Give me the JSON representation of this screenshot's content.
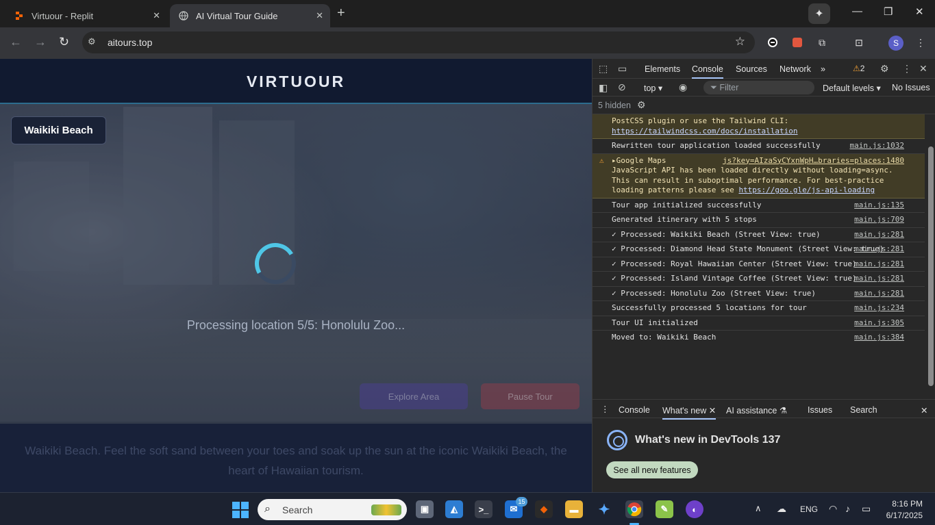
{
  "browser": {
    "tabs": [
      {
        "title": "Virtuour - Replit",
        "favicon": "replit-icon"
      },
      {
        "title": "AI Virtual Tour Guide",
        "favicon": "globe-icon"
      }
    ],
    "new_tab": "+",
    "url": "aitours.top",
    "profile_initial": "S"
  },
  "page": {
    "brand": "VIRTUOUR",
    "location_button": "Waikiki Beach",
    "status": "Processing location 5/5: Honolulu Zoo...",
    "explore_button": "Explore Area",
    "pause_button": "Pause Tour",
    "description": "Waikiki Beach. Feel the soft sand between your toes and soak up the sun at the iconic Waikiki Beach, the heart of Hawaiian tourism."
  },
  "devtools": {
    "tabs": [
      "Elements",
      "Console",
      "Sources",
      "Network"
    ],
    "more_tabs": "»",
    "warning_count": "2",
    "context": "top",
    "filter_placeholder": "Filter",
    "levels": "Default levels",
    "issues": "No Issues",
    "hidden": "5 hidden",
    "logs": [
      {
        "type": "warn",
        "text": "PostCSS plugin or use the Tailwind CLI:",
        "link": "https://tailwindcss.com/docs/installation",
        "source": ""
      },
      {
        "type": "log",
        "text": "Rewritten tour application loaded successfully",
        "source": "main.js:1032"
      },
      {
        "type": "warn",
        "head": "Google Maps",
        "text": "JavaScript API has been loaded directly without loading=async. This can result in suboptimal performance. For best-practice loading patterns please see",
        "link": "https://goo.gle/js-api-loading",
        "source": "js?key=AIzaSyCYxnWpH…braries=places:1480"
      },
      {
        "type": "log",
        "text": "Tour app initialized successfully",
        "source": "main.js:135"
      },
      {
        "type": "log",
        "text": "Generated itinerary with 5 stops",
        "source": "main.js:709"
      },
      {
        "type": "log",
        "text": "✓ Processed: Waikiki Beach (Street View: true)",
        "source": "main.js:281"
      },
      {
        "type": "log",
        "text": "✓ Processed: Diamond Head State Monument (Street View: true)",
        "source": "main.js:281"
      },
      {
        "type": "log",
        "text": "✓ Processed: Royal Hawaiian Center (Street View: true)",
        "source": "main.js:281"
      },
      {
        "type": "log",
        "text": "✓ Processed: Island Vintage Coffee (Street View: true)",
        "source": "main.js:281"
      },
      {
        "type": "log",
        "text": "✓ Processed: Honolulu Zoo (Street View: true)",
        "source": "main.js:281"
      },
      {
        "type": "log",
        "text": "Successfully processed 5 locations for tour",
        "source": "main.js:234"
      },
      {
        "type": "log",
        "text": "Tour UI initialized",
        "source": "main.js:305"
      },
      {
        "type": "log",
        "text": "Moved to: Waikiki Beach",
        "source": "main.js:384"
      }
    ],
    "prompt": "›",
    "drawer_tabs": [
      "Console",
      "What's new",
      "AI assistance",
      "Issues",
      "Search"
    ],
    "whats_new_title": "What's new in DevTools 137",
    "see_all": "See all new features"
  },
  "taskbar": {
    "search_placeholder": "Search",
    "badge": "15",
    "language": "ENG",
    "time": "8:16 PM",
    "date": "6/17/2025"
  }
}
